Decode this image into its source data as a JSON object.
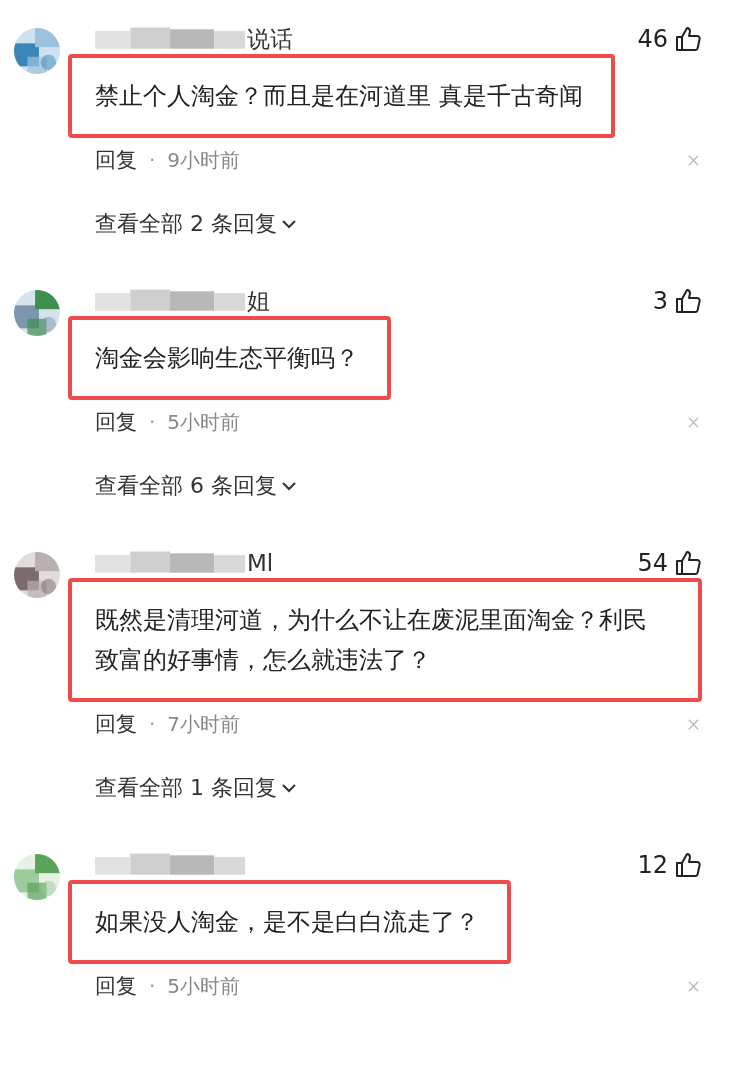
{
  "comments": [
    {
      "name_suffix": "说话",
      "likes": "46",
      "text": "禁止个人淘金？而且是在河道里 真是千古奇闻",
      "reply": "回复",
      "separator": "·",
      "time": "9小时前",
      "replies_link": "查看全部 2 条回复"
    },
    {
      "name_suffix": "姐",
      "likes": "3",
      "text": "淘金会影响生态平衡吗？",
      "reply": "回复",
      "separator": "·",
      "time": "5小时前",
      "replies_link": "查看全部 6 条回复"
    },
    {
      "name_suffix": "Ml",
      "likes": "54",
      "text": "既然是清理河道，为什么不让在废泥里面淘金？利民致富的好事情，怎么就违法了？",
      "reply": "回复",
      "separator": "·",
      "time": "7小时前",
      "replies_link": "查看全部 1 条回复"
    },
    {
      "likes": "12",
      "text": "如果没人淘金，是不是白白流走了？",
      "reply": "回复",
      "separator": "·",
      "time": "5小时前"
    }
  ]
}
